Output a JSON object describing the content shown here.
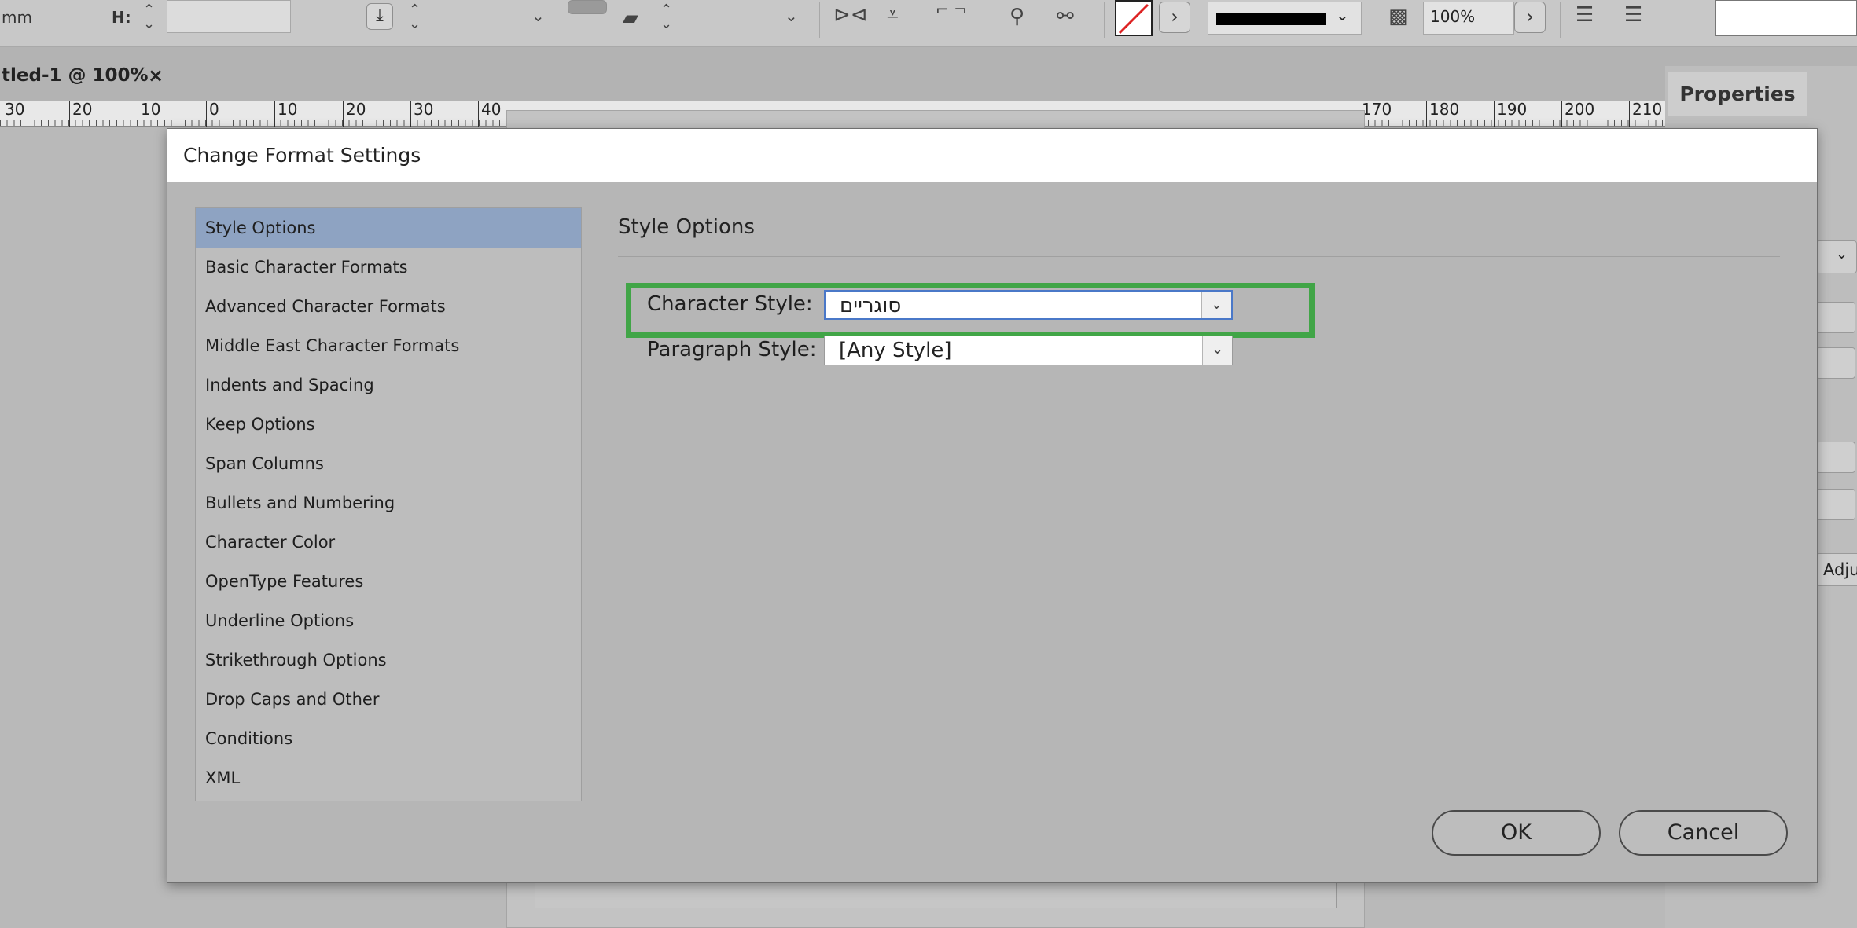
{
  "toolbar": {
    "unit_text": "mm",
    "h_label": "H:",
    "zoom_value": "100%"
  },
  "document_tab": {
    "title": "tled-1 @ 100%",
    "close_glyph": "×"
  },
  "ruler": {
    "labels": [
      "30",
      "20",
      "10",
      "0",
      "10",
      "20",
      "30",
      "40",
      "170",
      "180",
      "190",
      "200",
      "210"
    ]
  },
  "properties_panel": {
    "tab_label": "Properties",
    "partial_button": "Adju"
  },
  "dialog": {
    "title": "Change Format Settings",
    "nav_items": [
      "Style Options",
      "Basic Character Formats",
      "Advanced Character Formats",
      "Middle East Character Formats",
      "Indents and Spacing",
      "Keep Options",
      "Span Columns",
      "Bullets and Numbering",
      "Character Color",
      "OpenType Features",
      "Underline Options",
      "Strikethrough Options",
      "Drop Caps and Other",
      "Conditions",
      "XML"
    ],
    "selected_nav": "Style Options",
    "section_title": "Style Options",
    "character_style": {
      "label": "Character Style:",
      "value": "סוגריים"
    },
    "paragraph_style": {
      "label": "Paragraph Style:",
      "value": "[Any Style]"
    },
    "ok_label": "OK",
    "cancel_label": "Cancel"
  },
  "colors": {
    "highlight_box": "#41a547",
    "selected_nav": "#8ea3c2"
  }
}
